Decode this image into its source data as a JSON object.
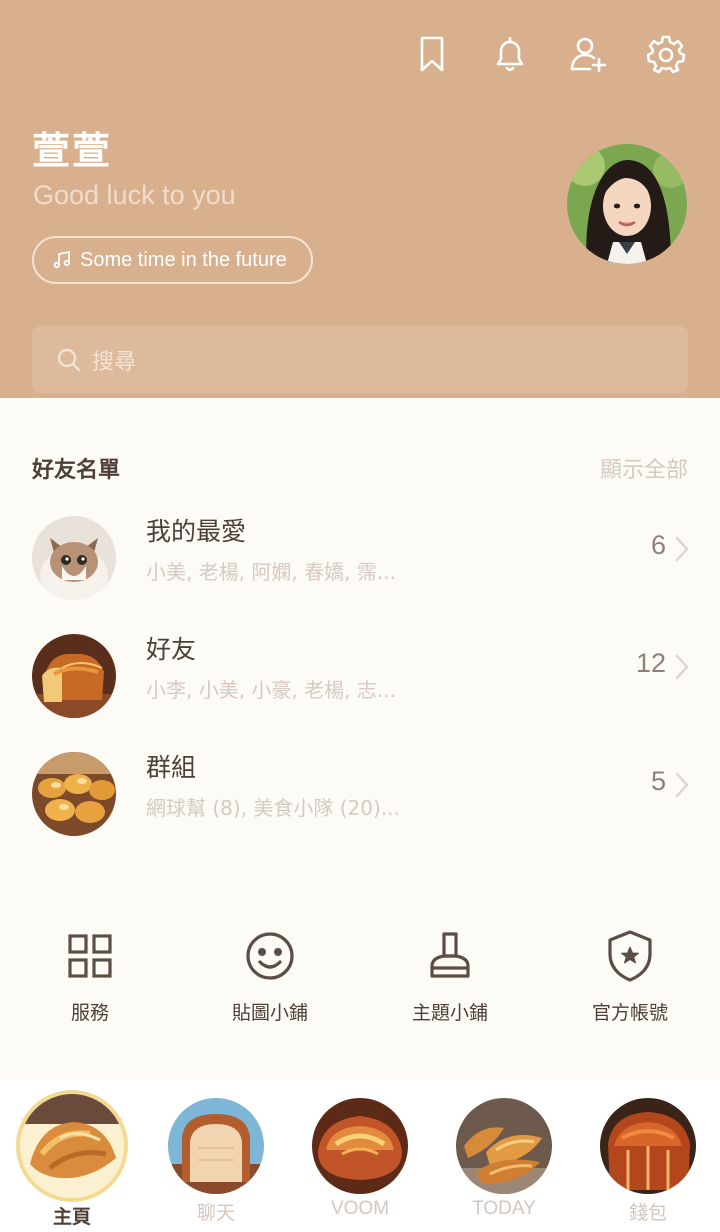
{
  "header": {
    "profile_name": "萱萱",
    "status_message": "Good luck to you",
    "music": "Some time in the future",
    "search_placeholder": "搜尋",
    "icons": [
      "bookmark-icon",
      "bell-icon",
      "add-friend-icon",
      "gear-icon"
    ]
  },
  "friends": {
    "title": "好友名單",
    "show_all": "顯示全部",
    "items": [
      {
        "title": "我的最愛",
        "subtitle": "小美, 老楊, 阿嫻, 春嬌, 霈...",
        "count": "6",
        "thumb": "cat-photo"
      },
      {
        "title": "好友",
        "subtitle": "小李, 小美, 小豪, 老楊, 志...",
        "count": "12",
        "thumb": "bread-loaf-photo"
      },
      {
        "title": "群組",
        "subtitle": "網球幫 (8), 美食小隊 (20)...",
        "count": "5",
        "thumb": "buns-photo"
      }
    ]
  },
  "quick_services": [
    {
      "label": "服務",
      "icon": "grid-icon"
    },
    {
      "label": "貼圖小鋪",
      "icon": "smiley-icon"
    },
    {
      "label": "主題小鋪",
      "icon": "brush-icon"
    },
    {
      "label": "官方帳號",
      "icon": "shield-star-icon"
    }
  ],
  "bottom_nav": {
    "active": "主頁",
    "tabs": [
      {
        "label": "主頁",
        "icon": "croissant-icon"
      },
      {
        "label": "聊天",
        "icon": "toast-icon"
      },
      {
        "label": "VOOM",
        "icon": "bread-icon"
      },
      {
        "label": "TODAY",
        "icon": "croissants-icon"
      },
      {
        "label": "錢包",
        "icon": "brioche-icon"
      }
    ]
  },
  "colors": {
    "header_bg": "#D9B08E",
    "page_bg": "#FDFBF5",
    "text_dark": "#4E4038",
    "text_muted": "#D6CAC2",
    "active_ring": "#F4DA90"
  }
}
